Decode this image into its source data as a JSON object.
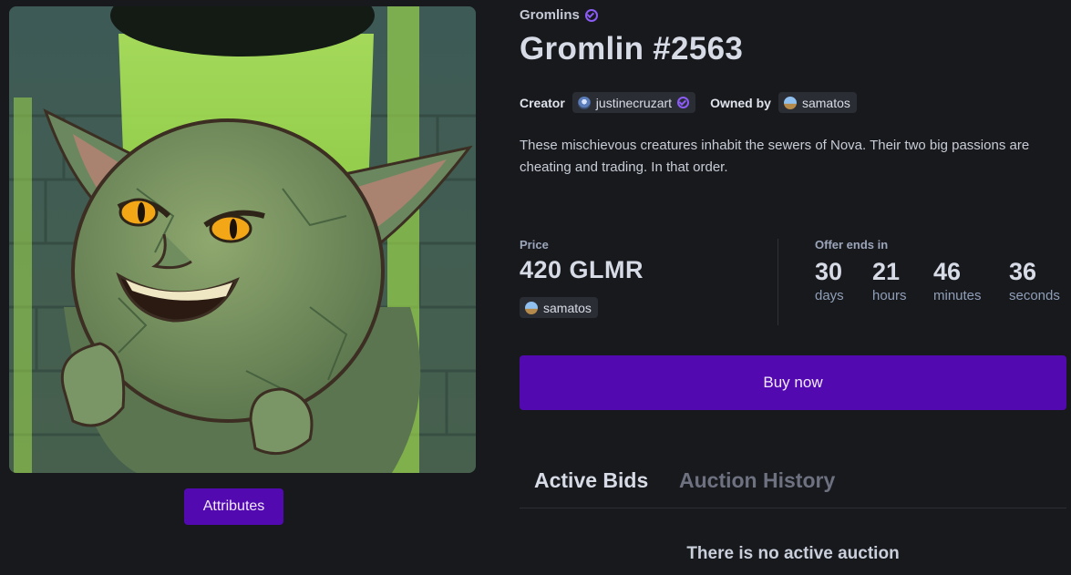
{
  "collection": {
    "name": "Gromlins",
    "verified": true
  },
  "nft": {
    "title": "Gromlin #2563",
    "image_alt": "Green goblin character in a sewer",
    "description": "These mischievous creatures inhabit the sewers of Nova. Their two big passions are cheating and trading. In that order."
  },
  "creator": {
    "label": "Creator",
    "name": "justinecruzart",
    "verified": true
  },
  "owner": {
    "label": "Owned by",
    "name": "samatos"
  },
  "sale": {
    "price_label": "Price",
    "price": "420 GLMR",
    "seller": "samatos"
  },
  "countdown": {
    "label": "Offer ends in",
    "units": [
      {
        "value": "30",
        "label": "days"
      },
      {
        "value": "21",
        "label": "hours"
      },
      {
        "value": "46",
        "label": "minutes"
      },
      {
        "value": "36",
        "label": "seconds"
      }
    ]
  },
  "actions": {
    "buy_label": "Buy now",
    "attributes_label": "Attributes"
  },
  "tabs": [
    {
      "label": "Active Bids",
      "active": true
    },
    {
      "label": "Auction History",
      "active": false
    }
  ],
  "bids": {
    "empty_message": "There is no active auction"
  },
  "colors": {
    "accent": "#5209b0",
    "background": "#18191d",
    "verified": "#8b5cf6"
  }
}
